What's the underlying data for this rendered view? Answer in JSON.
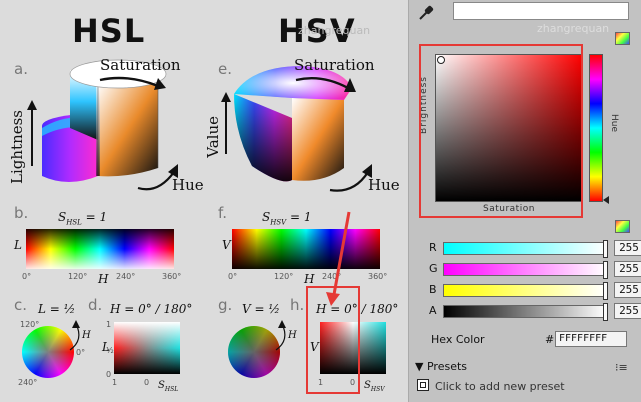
{
  "diagram": {
    "hsl_title": "HSL",
    "hsv_title": "HSV",
    "watermark": "zhangrequan",
    "section_a": "a.",
    "section_b": "b.",
    "section_c": "c.",
    "section_d": "d.",
    "section_e": "e.",
    "section_f": "f.",
    "section_g": "g.",
    "section_h": "h.",
    "saturation": "Saturation",
    "lightness": "Lightness",
    "value": "Value",
    "hue": "Hue",
    "s_hsl_eq": "S",
    "s_hsl_sub": "HSL",
    "s_eq_one": " = 1",
    "s_hsv_sub": "HSV",
    "axis_L": "L",
    "axis_V": "V",
    "axis_H": "H",
    "tick_0": "0°",
    "tick_120": "120°",
    "tick_240": "240°",
    "tick_360": "360°",
    "l_half": "L = ½",
    "v_half": "V = ½",
    "h_eq_0_180": "H = 0° / 180°",
    "wheel_120": "120°",
    "wheel_0": "0°",
    "wheel_240": "240°",
    "small_1": "1",
    "small_0": "0",
    "small_half": "½"
  },
  "panel": {
    "hex_field_value": "",
    "brightness_label": "Brightness",
    "saturation_label": "Saturation",
    "hue_label": "Hue",
    "watermark": "zhangrequan",
    "channels": [
      {
        "label": "R",
        "value": "255",
        "gradient_from": "#00ffff",
        "gradient_to": "#ffffff"
      },
      {
        "label": "G",
        "value": "255",
        "gradient_from": "#ff00ff",
        "gradient_to": "#ffffff"
      },
      {
        "label": "B",
        "value": "255",
        "gradient_from": "#ffff00",
        "gradient_to": "#ffffff"
      },
      {
        "label": "A",
        "value": "255",
        "gradient_from": "#000000",
        "gradient_to": "#ffffff"
      }
    ],
    "hex_color_label": "Hex Color",
    "hash": "#",
    "hex_value": "FFFFFFFF",
    "presets_label": "Presets",
    "add_preset_label": "Click to add new preset"
  },
  "colors": {
    "highlight": "#e53935",
    "panel_bg": "#c2c2c2",
    "diagram_bg": "#dcdcdc",
    "selected_hue": "#ff0000"
  }
}
